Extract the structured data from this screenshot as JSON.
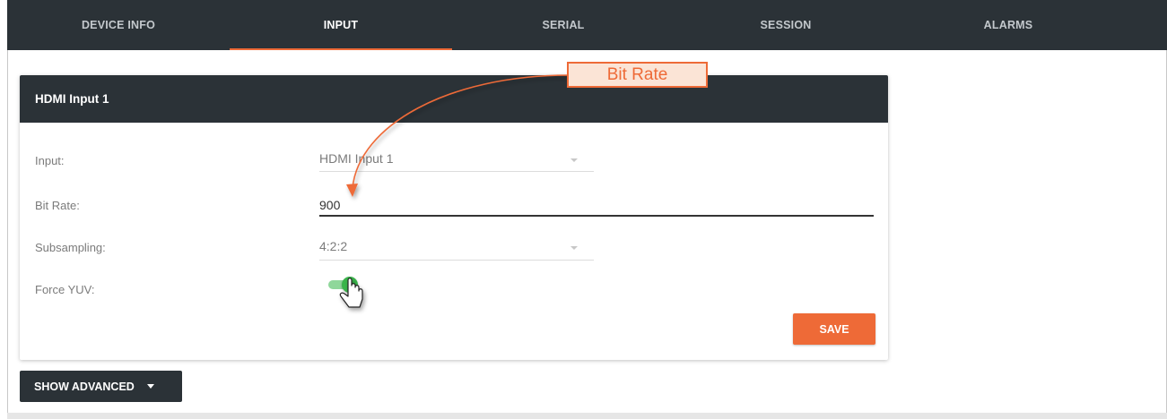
{
  "tabs": [
    {
      "label": "DEVICE INFO",
      "active": false
    },
    {
      "label": "INPUT",
      "active": true
    },
    {
      "label": "SERIAL",
      "active": false
    },
    {
      "label": "SESSION",
      "active": false
    },
    {
      "label": "ALARMS",
      "active": false
    }
  ],
  "card": {
    "title": "HDMI Input 1",
    "fields": {
      "input": {
        "label": "Input:",
        "value": "HDMI Input 1"
      },
      "bit_rate": {
        "label": "Bit Rate:",
        "value": "900"
      },
      "subsampling": {
        "label": "Subsampling:",
        "value": "4:2:2"
      },
      "force_yuv": {
        "label": "Force YUV:",
        "enabled": true
      }
    },
    "save_label": "SAVE"
  },
  "advanced_label": "SHOW ADVANCED",
  "annotation": {
    "callout_text": "Bit Rate"
  },
  "colors": {
    "header_bg": "#2b3237",
    "accent_orange": "#ee6a37",
    "toggle_green": "#39b54a",
    "toggle_track": "#8fd79a"
  },
  "icons": {
    "dropdown": "chevron-down-icon",
    "cursor": "hand-pointer-icon",
    "arrow": "curved-arrow-icon"
  }
}
